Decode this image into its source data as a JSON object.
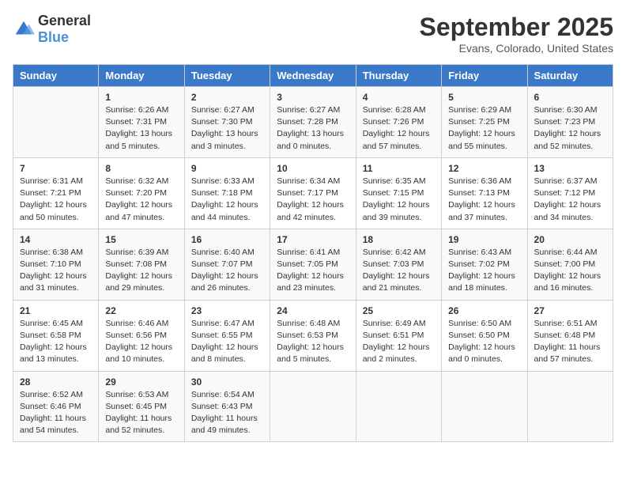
{
  "logo": {
    "general": "General",
    "blue": "Blue"
  },
  "title": "September 2025",
  "subtitle": "Evans, Colorado, United States",
  "days_header": [
    "Sunday",
    "Monday",
    "Tuesday",
    "Wednesday",
    "Thursday",
    "Friday",
    "Saturday"
  ],
  "weeks": [
    [
      {
        "day": "",
        "sunrise": "",
        "sunset": "",
        "daylight": ""
      },
      {
        "day": "1",
        "sunrise": "Sunrise: 6:26 AM",
        "sunset": "Sunset: 7:31 PM",
        "daylight": "Daylight: 13 hours and 5 minutes."
      },
      {
        "day": "2",
        "sunrise": "Sunrise: 6:27 AM",
        "sunset": "Sunset: 7:30 PM",
        "daylight": "Daylight: 13 hours and 3 minutes."
      },
      {
        "day": "3",
        "sunrise": "Sunrise: 6:27 AM",
        "sunset": "Sunset: 7:28 PM",
        "daylight": "Daylight: 13 hours and 0 minutes."
      },
      {
        "day": "4",
        "sunrise": "Sunrise: 6:28 AM",
        "sunset": "Sunset: 7:26 PM",
        "daylight": "Daylight: 12 hours and 57 minutes."
      },
      {
        "day": "5",
        "sunrise": "Sunrise: 6:29 AM",
        "sunset": "Sunset: 7:25 PM",
        "daylight": "Daylight: 12 hours and 55 minutes."
      },
      {
        "day": "6",
        "sunrise": "Sunrise: 6:30 AM",
        "sunset": "Sunset: 7:23 PM",
        "daylight": "Daylight: 12 hours and 52 minutes."
      }
    ],
    [
      {
        "day": "7",
        "sunrise": "Sunrise: 6:31 AM",
        "sunset": "Sunset: 7:21 PM",
        "daylight": "Daylight: 12 hours and 50 minutes."
      },
      {
        "day": "8",
        "sunrise": "Sunrise: 6:32 AM",
        "sunset": "Sunset: 7:20 PM",
        "daylight": "Daylight: 12 hours and 47 minutes."
      },
      {
        "day": "9",
        "sunrise": "Sunrise: 6:33 AM",
        "sunset": "Sunset: 7:18 PM",
        "daylight": "Daylight: 12 hours and 44 minutes."
      },
      {
        "day": "10",
        "sunrise": "Sunrise: 6:34 AM",
        "sunset": "Sunset: 7:17 PM",
        "daylight": "Daylight: 12 hours and 42 minutes."
      },
      {
        "day": "11",
        "sunrise": "Sunrise: 6:35 AM",
        "sunset": "Sunset: 7:15 PM",
        "daylight": "Daylight: 12 hours and 39 minutes."
      },
      {
        "day": "12",
        "sunrise": "Sunrise: 6:36 AM",
        "sunset": "Sunset: 7:13 PM",
        "daylight": "Daylight: 12 hours and 37 minutes."
      },
      {
        "day": "13",
        "sunrise": "Sunrise: 6:37 AM",
        "sunset": "Sunset: 7:12 PM",
        "daylight": "Daylight: 12 hours and 34 minutes."
      }
    ],
    [
      {
        "day": "14",
        "sunrise": "Sunrise: 6:38 AM",
        "sunset": "Sunset: 7:10 PM",
        "daylight": "Daylight: 12 hours and 31 minutes."
      },
      {
        "day": "15",
        "sunrise": "Sunrise: 6:39 AM",
        "sunset": "Sunset: 7:08 PM",
        "daylight": "Daylight: 12 hours and 29 minutes."
      },
      {
        "day": "16",
        "sunrise": "Sunrise: 6:40 AM",
        "sunset": "Sunset: 7:07 PM",
        "daylight": "Daylight: 12 hours and 26 minutes."
      },
      {
        "day": "17",
        "sunrise": "Sunrise: 6:41 AM",
        "sunset": "Sunset: 7:05 PM",
        "daylight": "Daylight: 12 hours and 23 minutes."
      },
      {
        "day": "18",
        "sunrise": "Sunrise: 6:42 AM",
        "sunset": "Sunset: 7:03 PM",
        "daylight": "Daylight: 12 hours and 21 minutes."
      },
      {
        "day": "19",
        "sunrise": "Sunrise: 6:43 AM",
        "sunset": "Sunset: 7:02 PM",
        "daylight": "Daylight: 12 hours and 18 minutes."
      },
      {
        "day": "20",
        "sunrise": "Sunrise: 6:44 AM",
        "sunset": "Sunset: 7:00 PM",
        "daylight": "Daylight: 12 hours and 16 minutes."
      }
    ],
    [
      {
        "day": "21",
        "sunrise": "Sunrise: 6:45 AM",
        "sunset": "Sunset: 6:58 PM",
        "daylight": "Daylight: 12 hours and 13 minutes."
      },
      {
        "day": "22",
        "sunrise": "Sunrise: 6:46 AM",
        "sunset": "Sunset: 6:56 PM",
        "daylight": "Daylight: 12 hours and 10 minutes."
      },
      {
        "day": "23",
        "sunrise": "Sunrise: 6:47 AM",
        "sunset": "Sunset: 6:55 PM",
        "daylight": "Daylight: 12 hours and 8 minutes."
      },
      {
        "day": "24",
        "sunrise": "Sunrise: 6:48 AM",
        "sunset": "Sunset: 6:53 PM",
        "daylight": "Daylight: 12 hours and 5 minutes."
      },
      {
        "day": "25",
        "sunrise": "Sunrise: 6:49 AM",
        "sunset": "Sunset: 6:51 PM",
        "daylight": "Daylight: 12 hours and 2 minutes."
      },
      {
        "day": "26",
        "sunrise": "Sunrise: 6:50 AM",
        "sunset": "Sunset: 6:50 PM",
        "daylight": "Daylight: 12 hours and 0 minutes."
      },
      {
        "day": "27",
        "sunrise": "Sunrise: 6:51 AM",
        "sunset": "Sunset: 6:48 PM",
        "daylight": "Daylight: 11 hours and 57 minutes."
      }
    ],
    [
      {
        "day": "28",
        "sunrise": "Sunrise: 6:52 AM",
        "sunset": "Sunset: 6:46 PM",
        "daylight": "Daylight: 11 hours and 54 minutes."
      },
      {
        "day": "29",
        "sunrise": "Sunrise: 6:53 AM",
        "sunset": "Sunset: 6:45 PM",
        "daylight": "Daylight: 11 hours and 52 minutes."
      },
      {
        "day": "30",
        "sunrise": "Sunrise: 6:54 AM",
        "sunset": "Sunset: 6:43 PM",
        "daylight": "Daylight: 11 hours and 49 minutes."
      },
      {
        "day": "",
        "sunrise": "",
        "sunset": "",
        "daylight": ""
      },
      {
        "day": "",
        "sunrise": "",
        "sunset": "",
        "daylight": ""
      },
      {
        "day": "",
        "sunrise": "",
        "sunset": "",
        "daylight": ""
      },
      {
        "day": "",
        "sunrise": "",
        "sunset": "",
        "daylight": ""
      }
    ]
  ]
}
